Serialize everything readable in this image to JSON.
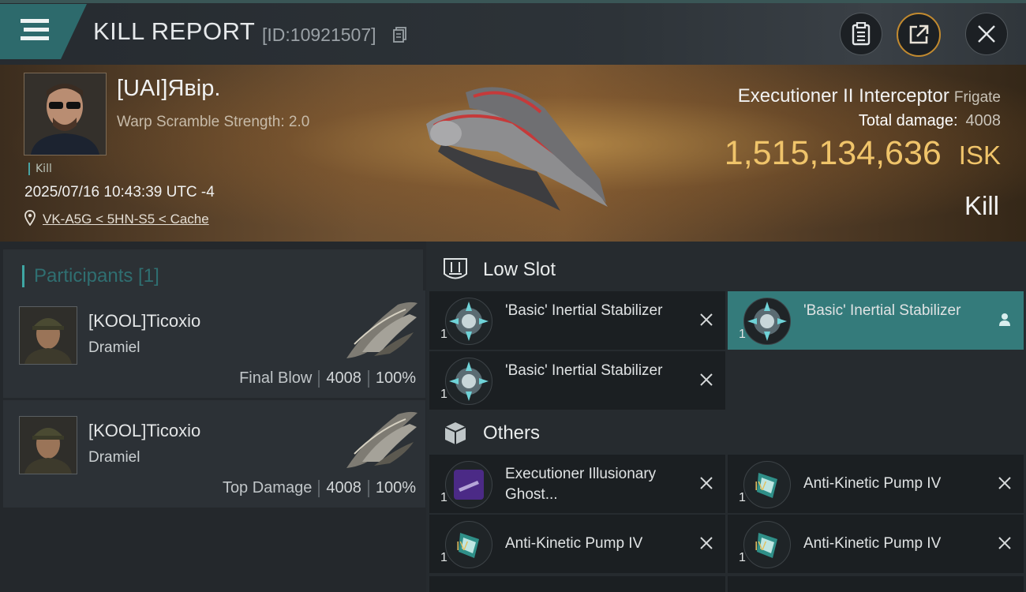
{
  "header": {
    "title": "KILL REPORT",
    "report_id": "[ID:10921507]",
    "buttons": [
      "clipboard-icon",
      "share-icon",
      "close-icon"
    ]
  },
  "victim": {
    "pilot_name": "[UAI]Явір.",
    "warp_scramble": "Warp Scramble Strength: 2.0",
    "tag": "Kill",
    "datetime": "2025/07/16 10:43:39 UTC -4",
    "location": "VK-A5G < 5HN-S5 < Cache",
    "ship_name": "Executioner II Interceptor",
    "ship_class": "Frigate",
    "total_damage_label": "Total damage:",
    "total_damage_value": "4008",
    "isk_value": "1,515,134,636",
    "isk_unit": "ISK",
    "result": "Kill"
  },
  "participants": {
    "title": "Participants [1]",
    "items": [
      {
        "name": "[KOOL]Ticoxio",
        "ship": "Dramiel",
        "role": "Final Blow",
        "damage": "4008",
        "percent": "100%"
      },
      {
        "name": "[KOOL]Ticoxio",
        "ship": "Dramiel",
        "role": "Top Damage",
        "damage": "4008",
        "percent": "100%"
      }
    ]
  },
  "low_slot": {
    "title": "Low Slot",
    "items": [
      {
        "name": "'Basic' Inertial Stabilizer",
        "qty": "1",
        "action": "destroyed"
      },
      {
        "name": "'Basic' Inertial Stabilizer",
        "qty": "1",
        "action": "dropped"
      },
      {
        "name": "'Basic' Inertial Stabilizer",
        "qty": "1",
        "action": "destroyed"
      }
    ]
  },
  "others": {
    "title": "Others",
    "items": [
      {
        "name": "Executioner Illusionary Ghost...",
        "qty": "1",
        "level": ""
      },
      {
        "name": "Anti-Kinetic Pump IV",
        "qty": "1",
        "level": "IV"
      },
      {
        "name": "Anti-Kinetic Pump IV",
        "qty": "1",
        "level": "IV"
      },
      {
        "name": "Anti-Kinetic Pump IV",
        "qty": "1",
        "level": "IV"
      }
    ]
  },
  "colors": {
    "accent_teal": "#3fa7a4",
    "isk_gold": "#f0c46a",
    "selected_slot": "#347b7b"
  }
}
